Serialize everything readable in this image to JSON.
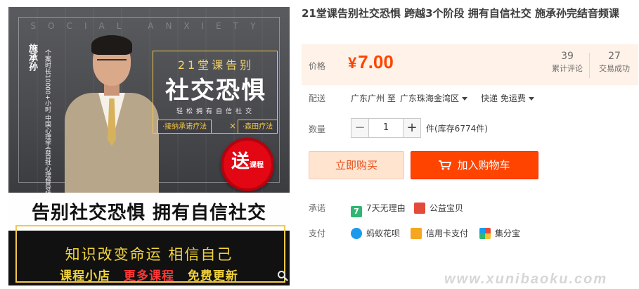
{
  "image": {
    "bg_text": "SOCIAL ANXIETY",
    "author_name": "施承孙",
    "author_desc": "个案时长10000+小时 中国心理学会首批心理督导师",
    "title_line1": "21堂课告别",
    "title_line2": "社交恐惧",
    "title_line3": "轻松拥有自信社交",
    "tag_left": "·接纳承诺疗法",
    "tag_sep": "×",
    "tag_right": "·森田疗法",
    "badge_big": "送",
    "badge_small": "课程",
    "banner": "告别社交恐惧 拥有自信社交",
    "bottom_line1": "知识改变命运  相信自己",
    "bottom_shop": "课程小店",
    "bottom_more": "更多课程",
    "bottom_free": "免费更新",
    "zoom_icon": "magnifier-icon"
  },
  "product": {
    "title": "21堂课告别社交恐惧 跨越3个阶段 拥有自信社交 施承孙完结音频课"
  },
  "price": {
    "label": "价格",
    "currency": "¥",
    "value": "7.00",
    "reviews_count": "39",
    "reviews_label": "累计评论",
    "deals_count": "27",
    "deals_label": "交易成功"
  },
  "shipping": {
    "label": "配送",
    "from": "广东广州 至",
    "to": "广东珠海金湾区",
    "method": "快递 免运费"
  },
  "quantity": {
    "label": "数量",
    "minus": "−",
    "value": "1",
    "plus": "+",
    "stock": "件(库存6774件)"
  },
  "actions": {
    "buy_now": "立即购买",
    "add_cart": "加入购物车"
  },
  "promise": {
    "label": "承诺",
    "items": [
      "7天无理由",
      "公益宝贝"
    ]
  },
  "payment": {
    "label": "支付",
    "items": [
      "蚂蚁花呗",
      "信用卡支付",
      "集分宝"
    ]
  },
  "watermark": "www.xunibaoku.com",
  "colors": {
    "accent": "#ff4400",
    "price": "#ff4400",
    "price_bg": "#fff2e8",
    "buy_bg": "#ffe4d0"
  }
}
